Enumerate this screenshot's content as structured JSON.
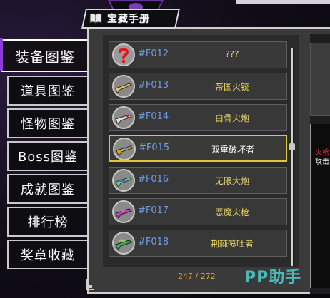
{
  "header": {
    "title": "宝藏手册",
    "icon": "book-icon"
  },
  "menu": [
    {
      "label": "装备图鉴",
      "active": true
    },
    {
      "label": "道具图鉴",
      "active": false
    },
    {
      "label": "怪物图鉴",
      "active": false
    },
    {
      "label": "Boss图鉴",
      "active": false
    },
    {
      "label": "成就图鉴",
      "active": false
    },
    {
      "label": "排行榜",
      "active": false
    },
    {
      "label": "奖章收藏",
      "active": false
    }
  ],
  "list": [
    {
      "code": "#F012",
      "name": "???",
      "icon": "unknown-question-icon",
      "selected": false
    },
    {
      "code": "#F013",
      "name": "帝国火铳",
      "icon": "gun-icon",
      "selected": false
    },
    {
      "code": "#F014",
      "name": "白骨火炮",
      "icon": "gun-icon",
      "selected": false
    },
    {
      "code": "#F015",
      "name": "双重破坏者",
      "icon": "gun-icon",
      "selected": true
    },
    {
      "code": "#F016",
      "name": "无限大炮",
      "icon": "gun-icon",
      "selected": false
    },
    {
      "code": "#F017",
      "name": "恶魔火枪",
      "icon": "gun-icon",
      "selected": false
    },
    {
      "code": "#F018",
      "name": "荆棘喷吐者",
      "icon": "gun-icon",
      "selected": false
    }
  ],
  "counter": "247 / 272",
  "detail": {
    "line1": "火枪",
    "line2": "攻击"
  },
  "watermark": "PP助手",
  "colors": {
    "accent": "#8b3bd6",
    "code": "#6f9be3",
    "name": "#ead56a",
    "selected_border": "#d9c83a",
    "counter": "#e0a640"
  }
}
